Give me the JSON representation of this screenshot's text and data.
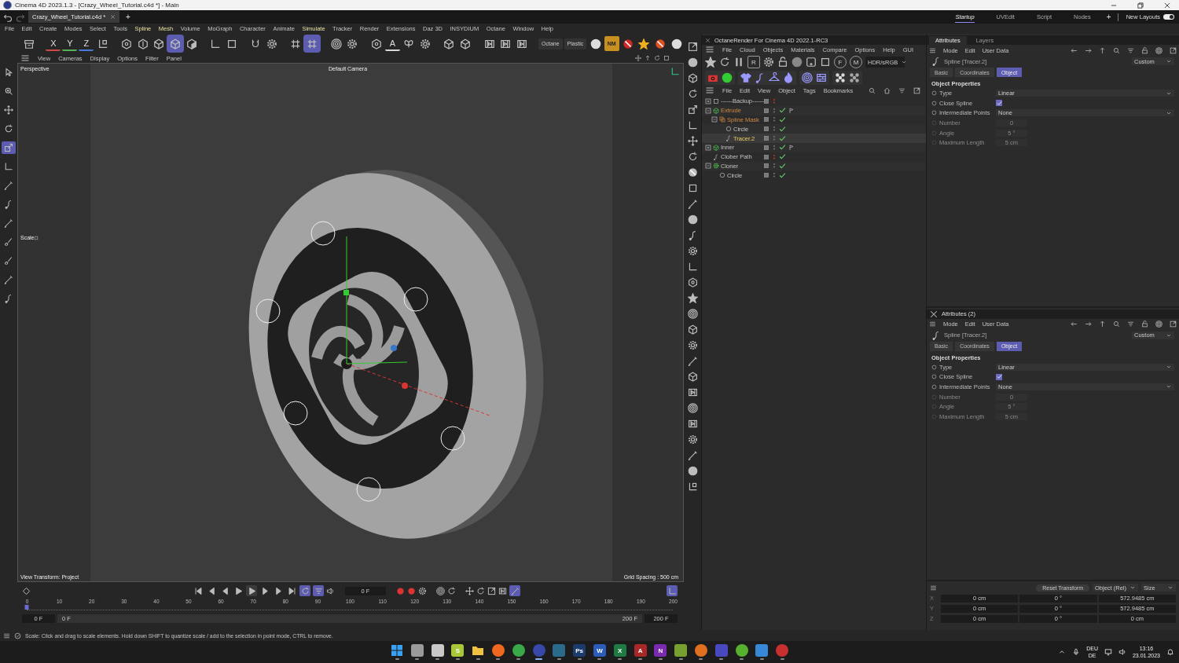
{
  "window": {
    "title": "Cinema 4D 2023.1.3 - [Crazy_Wheel_Tutorial.c4d *] - Main"
  },
  "doc_tabs": [
    {
      "label": "Crazy_Wheel_Tutorial.c4d *",
      "selected": true
    }
  ],
  "new_tab": "+",
  "layouts": [
    {
      "label": "Startup",
      "selected": true
    },
    {
      "label": "UVEdit",
      "selected": false
    },
    {
      "label": "Script",
      "selected": false
    },
    {
      "label": "Nodes",
      "selected": false
    }
  ],
  "add_layout": "+",
  "new_layouts": {
    "label": "New Layouts",
    "on": true
  },
  "menu": [
    {
      "label": "File",
      "highlighted": false
    },
    {
      "label": "Edit",
      "highlighted": false
    },
    {
      "label": "Create",
      "highlighted": false
    },
    {
      "label": "Modes",
      "highlighted": false
    },
    {
      "label": "Select",
      "highlighted": false
    },
    {
      "label": "Tools",
      "highlighted": false
    },
    {
      "label": "Spline",
      "highlighted": true
    },
    {
      "label": "Mesh",
      "highlighted": true
    },
    {
      "label": "Volume",
      "highlighted": false
    },
    {
      "label": "MoGraph",
      "highlighted": false
    },
    {
      "label": "Character",
      "highlighted": false
    },
    {
      "label": "Animate",
      "highlighted": false
    },
    {
      "label": "Simulate",
      "highlighted": true
    },
    {
      "label": "Tracker",
      "highlighted": false
    },
    {
      "label": "Render",
      "highlighted": false
    },
    {
      "label": "Extensions",
      "highlighted": false
    },
    {
      "label": "Daz 3D",
      "highlighted": false
    },
    {
      "label": "INSYDIUM",
      "highlighted": false
    },
    {
      "label": "Octane",
      "highlighted": false
    },
    {
      "label": "Window",
      "highlighted": false
    },
    {
      "label": "Help",
      "highlighted": false
    }
  ],
  "toolbar": [
    {
      "kind": "box",
      "selected": false
    },
    {
      "kind": "sep"
    },
    {
      "kind": "letter",
      "label": "X",
      "color": "#d04848",
      "selected": false
    },
    {
      "kind": "letter",
      "label": "Y",
      "color": "#58b058",
      "selected": false
    },
    {
      "kind": "letter",
      "label": "Z",
      "color": "#4878d8",
      "selected": false
    },
    {
      "kind": "coord",
      "selected": false
    },
    {
      "kind": "sep"
    },
    {
      "kind": "hexagon",
      "selected": false
    },
    {
      "kind": "edge",
      "selected": false
    },
    {
      "kind": "cube",
      "selected": false
    },
    {
      "kind": "cube",
      "selected": true
    },
    {
      "kind": "texture",
      "selected": false
    },
    {
      "kind": "sep"
    },
    {
      "kind": "axis",
      "selected": false
    },
    {
      "kind": "square",
      "selected": false
    },
    {
      "kind": "sep"
    },
    {
      "kind": "magnet",
      "selected": false
    },
    {
      "kind": "gear",
      "selected": false
    },
    {
      "kind": "sep"
    },
    {
      "kind": "grid",
      "selected": false
    },
    {
      "kind": "grid",
      "selected": true
    },
    {
      "kind": "sep"
    },
    {
      "kind": "target",
      "selected": false
    },
    {
      "kind": "gear",
      "selected": false
    },
    {
      "kind": "sep"
    },
    {
      "kind": "hexagon",
      "selected": false
    },
    {
      "kind": "letter",
      "label": "A",
      "color": "#d8d8d8",
      "selected": false
    },
    {
      "kind": "butterfly",
      "selected": false
    },
    {
      "kind": "gear",
      "selected": false
    },
    {
      "kind": "sep"
    },
    {
      "kind": "cube",
      "selected": false
    },
    {
      "kind": "cube",
      "selected": false
    },
    {
      "kind": "sep"
    },
    {
      "kind": "film",
      "selected": false
    },
    {
      "kind": "film",
      "selected": false
    },
    {
      "kind": "film",
      "selected": false
    },
    {
      "kind": "sep"
    },
    {
      "kind": "text",
      "label": "Octane",
      "selected": false
    },
    {
      "kind": "text",
      "label": "Plastic",
      "selected": false
    },
    {
      "kind": "sphere",
      "selected": false
    },
    {
      "kind": "tile",
      "label": "NM",
      "color": "#c89020",
      "selected": false
    },
    {
      "kind": "ban",
      "color": "#d02828",
      "selected": false
    },
    {
      "kind": "star",
      "color": "#f0b020",
      "selected": false
    },
    {
      "kind": "ban",
      "color": "#e05020",
      "selected": false
    },
    {
      "kind": "sphere",
      "selected": false
    }
  ],
  "viewport": {
    "menu": [
      "View",
      "Cameras",
      "Display",
      "Options",
      "Filter",
      "Panel"
    ],
    "camera_view": "Perspective",
    "camera": "Default Camera",
    "tool_label": "Scale",
    "view_transform": "View Transform: Project",
    "grid_spacing": "Grid Spacing : 500 cm"
  },
  "left_tools": [
    {
      "kind": "cursor",
      "selected": false
    },
    {
      "kind": "select",
      "selected": false
    },
    {
      "kind": "move",
      "selected": false
    },
    {
      "kind": "rotate",
      "selected": false
    },
    {
      "kind": "scale",
      "selected": true
    },
    {
      "kind": "axis",
      "selected": false
    },
    {
      "kind": "pen",
      "selected": false
    },
    {
      "kind": "spline",
      "selected": false
    },
    {
      "kind": "pen",
      "selected": false
    },
    {
      "kind": "brush",
      "selected": false
    },
    {
      "kind": "brush",
      "selected": false
    },
    {
      "kind": "pen",
      "selected": false
    },
    {
      "kind": "spline",
      "selected": false
    }
  ],
  "timeline": {
    "frame": "0 F",
    "level": 0,
    "ruler": [
      "0",
      "10",
      "20",
      "30",
      "40",
      "50",
      "60",
      "70",
      "80",
      "90",
      "100",
      "110",
      "120",
      "130",
      "140",
      "150",
      "160",
      "170",
      "180",
      "190",
      "200"
    ],
    "start": "0 F",
    "range_start": "0 F",
    "range_end": "200 F",
    "end": "200 F"
  },
  "octane": {
    "title": "OctaneRender For Cinema 4D 2022.1-RC3",
    "menu": [
      "File",
      "Cloud",
      "Objects",
      "Materials",
      "Compare",
      "Options",
      "Help",
      "GUI"
    ],
    "toolbar": [
      {
        "kind": "star"
      },
      {
        "kind": "rotate"
      },
      {
        "kind": "pause"
      },
      {
        "kind": "letter-box",
        "label": "R"
      },
      {
        "kind": "gear"
      },
      {
        "kind": "lock"
      },
      {
        "kind": "sphere"
      },
      {
        "kind": "square-plus"
      },
      {
        "kind": "square"
      },
      {
        "kind": "letter-pin",
        "label": "F"
      },
      {
        "kind": "letter-pin",
        "label": "M"
      }
    ],
    "display": "HDR/sRGB"
  },
  "objects": {
    "menu": [
      "File",
      "Edit",
      "View",
      "Object",
      "Tags",
      "Bookmarks"
    ],
    "tree": [
      {
        "name": "------Backup------",
        "kind": "null",
        "expanded": false,
        "selected": false,
        "highlighted": false,
        "hidden": true,
        "enabled": false,
        "has_tag": false
      },
      {
        "name": "Extrude",
        "kind": "extrude",
        "expanded": true,
        "selected": false,
        "highlighted": true,
        "hidden": false,
        "enabled": true,
        "has_tag": true,
        "children": [
          {
            "name": "Spline Mask",
            "kind": "mask",
            "expanded": true,
            "selected": false,
            "highlighted": true,
            "hidden": false,
            "enabled": true,
            "has_tag": false,
            "children": [
              {
                "name": "Circle",
                "kind": "circle",
                "selected": false,
                "highlighted": false,
                "hidden": false,
                "enabled": true,
                "has_tag": false
              },
              {
                "name": "Tracer.2",
                "kind": "spline",
                "selected": true,
                "highlighted": false,
                "hidden": false,
                "enabled": true,
                "has_tag": false
              }
            ]
          }
        ]
      },
      {
        "name": "Inner",
        "kind": "extrude",
        "expanded": false,
        "selected": false,
        "highlighted": false,
        "hidden": false,
        "enabled": true,
        "has_tag": true
      },
      {
        "name": "Clober Path",
        "kind": "spline",
        "selected": false,
        "highlighted": false,
        "hidden": true,
        "enabled": true,
        "has_tag": false
      },
      {
        "name": "Cloner",
        "kind": "cloner",
        "expanded": true,
        "selected": false,
        "highlighted": false,
        "hidden": false,
        "enabled": true,
        "has_tag": false,
        "children": [
          {
            "name": "Circle",
            "kind": "circle",
            "selected": false,
            "highlighted": false,
            "hidden": false,
            "enabled": true,
            "has_tag": false
          }
        ]
      }
    ]
  },
  "attributes": [
    {
      "tabs": [
        {
          "label": "Attributes",
          "selected": true
        },
        {
          "label": "Layers",
          "selected": false
        }
      ],
      "menu": [
        "Mode",
        "Edit",
        "User Data"
      ],
      "object": "Spline [Tracer.2]",
      "mode": "Custom",
      "pages": [
        {
          "label": "Basic",
          "selected": false
        },
        {
          "label": "Coordinates",
          "selected": false
        },
        {
          "label": "Object",
          "selected": true
        }
      ],
      "section": "Object Properties",
      "fields": [
        {
          "kind": "dropdown",
          "label": "Type",
          "value": "Linear",
          "disabled": false
        },
        {
          "kind": "checkbox",
          "label": "Close Spline",
          "checked": true,
          "disabled": false
        },
        {
          "kind": "dropdown",
          "label": "Intermediate Points",
          "value": "None",
          "disabled": false
        },
        {
          "kind": "number",
          "label": "Number",
          "value": "0",
          "disabled": true
        },
        {
          "kind": "number",
          "label": "Angle",
          "value": "5 °",
          "disabled": true
        },
        {
          "kind": "number",
          "label": "Maximum Length",
          "value": "5 cm",
          "disabled": true
        }
      ]
    },
    {
      "title": "Attributes (2)",
      "menu": [
        "Mode",
        "Edit",
        "User Data"
      ],
      "object": "Spline [Tracer.2]",
      "mode": "Custom",
      "pages": [
        {
          "label": "Basic",
          "selected": false
        },
        {
          "label": "Coordinates",
          "selected": false
        },
        {
          "label": "Object",
          "selected": true
        }
      ],
      "section": "Object Properties",
      "fields": [
        {
          "kind": "dropdown",
          "label": "Type",
          "value": "Linear",
          "disabled": false
        },
        {
          "kind": "checkbox",
          "label": "Close Spline",
          "checked": true,
          "disabled": false
        },
        {
          "kind": "dropdown",
          "label": "Intermediate Points",
          "value": "None",
          "disabled": false
        },
        {
          "kind": "number",
          "label": "Number",
          "value": "0",
          "disabled": true
        },
        {
          "kind": "number",
          "label": "Angle",
          "value": "5 °",
          "disabled": true
        },
        {
          "kind": "number",
          "label": "Maximum Length",
          "value": "5 cm",
          "disabled": true
        }
      ]
    }
  ],
  "coordinates": {
    "button": "Reset Transform",
    "dropdowns": [
      "Object (Rel)",
      "Size"
    ],
    "rows": [
      {
        "axis": "X",
        "values": [
          "0 cm",
          "0 °",
          "572.9485 cm"
        ]
      },
      {
        "axis": "Y",
        "values": [
          "0 cm",
          "0 °",
          "572.9485 cm"
        ]
      },
      {
        "axis": "Z",
        "values": [
          "0 cm",
          "0 °",
          "0 cm"
        ]
      }
    ]
  },
  "status_bar": {
    "text": "Scale: Click and drag to scale elements. Hold down SHIFT to quantize scale / add to the selection in point mode, CTRL to remove."
  },
  "taskbar": {
    "apps": [
      {
        "kind": "start",
        "color": "#3aa0f0",
        "active": false
      },
      {
        "kind": "tile",
        "color": "#9a9a9a",
        "active": false
      },
      {
        "kind": "tile",
        "color": "#c8c8c8",
        "active": false
      },
      {
        "kind": "letter",
        "label": "S",
        "color": "#a8c838",
        "active": false
      },
      {
        "kind": "folder",
        "color": "#f0c040",
        "active": false
      },
      {
        "kind": "circle",
        "color": "#f06820",
        "active": false
      },
      {
        "kind": "circle",
        "color": "#38a848",
        "active": false
      },
      {
        "kind": "circle",
        "color": "#3848a8",
        "active": true
      },
      {
        "kind": "tile",
        "color": "#2a6a8a",
        "active": false
      },
      {
        "kind": "letter",
        "label": "Ps",
        "color": "#1c3c70",
        "active": false
      },
      {
        "kind": "letter",
        "label": "W",
        "color": "#2b5cb8",
        "active": false
      },
      {
        "kind": "letter",
        "label": "X",
        "color": "#1f7a44",
        "active": false
      },
      {
        "kind": "letter",
        "label": "A",
        "color": "#a82828",
        "active": false
      },
      {
        "kind": "letter",
        "label": "N",
        "color": "#7a2ab0",
        "active": false
      },
      {
        "kind": "tile",
        "color": "#78a030",
        "active": false
      },
      {
        "kind": "circle",
        "color": "#e07020",
        "active": false
      },
      {
        "kind": "tile",
        "color": "#4848c0",
        "active": false
      },
      {
        "kind": "circle",
        "color": "#58b030",
        "active": false
      },
      {
        "kind": "tile",
        "color": "#3888d8",
        "active": false
      },
      {
        "kind": "circle",
        "color": "#c83030",
        "active": false
      }
    ],
    "tray": {
      "language": "DEU",
      "layout": "DE",
      "time": "13:16",
      "date": "23.01.2023"
    }
  }
}
